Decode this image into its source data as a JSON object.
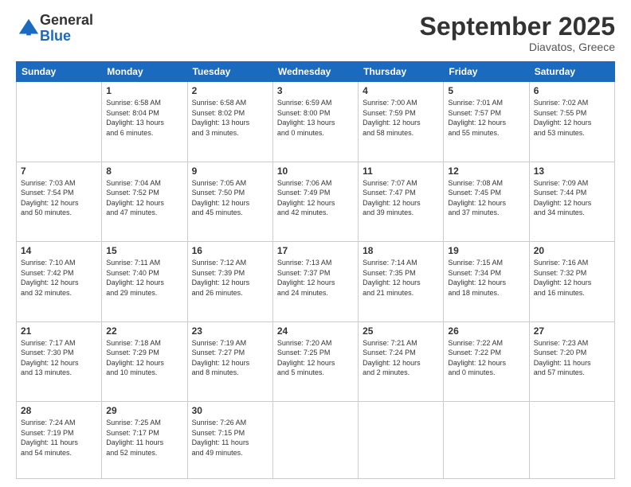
{
  "logo": {
    "general": "General",
    "blue": "Blue"
  },
  "title": "September 2025",
  "location": "Diavatos, Greece",
  "days_of_week": [
    "Sunday",
    "Monday",
    "Tuesday",
    "Wednesday",
    "Thursday",
    "Friday",
    "Saturday"
  ],
  "weeks": [
    [
      {
        "day": "",
        "info": ""
      },
      {
        "day": "1",
        "info": "Sunrise: 6:58 AM\nSunset: 8:04 PM\nDaylight: 13 hours\nand 6 minutes."
      },
      {
        "day": "2",
        "info": "Sunrise: 6:58 AM\nSunset: 8:02 PM\nDaylight: 13 hours\nand 3 minutes."
      },
      {
        "day": "3",
        "info": "Sunrise: 6:59 AM\nSunset: 8:00 PM\nDaylight: 13 hours\nand 0 minutes."
      },
      {
        "day": "4",
        "info": "Sunrise: 7:00 AM\nSunset: 7:59 PM\nDaylight: 12 hours\nand 58 minutes."
      },
      {
        "day": "5",
        "info": "Sunrise: 7:01 AM\nSunset: 7:57 PM\nDaylight: 12 hours\nand 55 minutes."
      },
      {
        "day": "6",
        "info": "Sunrise: 7:02 AM\nSunset: 7:55 PM\nDaylight: 12 hours\nand 53 minutes."
      }
    ],
    [
      {
        "day": "7",
        "info": "Sunrise: 7:03 AM\nSunset: 7:54 PM\nDaylight: 12 hours\nand 50 minutes."
      },
      {
        "day": "8",
        "info": "Sunrise: 7:04 AM\nSunset: 7:52 PM\nDaylight: 12 hours\nand 47 minutes."
      },
      {
        "day": "9",
        "info": "Sunrise: 7:05 AM\nSunset: 7:50 PM\nDaylight: 12 hours\nand 45 minutes."
      },
      {
        "day": "10",
        "info": "Sunrise: 7:06 AM\nSunset: 7:49 PM\nDaylight: 12 hours\nand 42 minutes."
      },
      {
        "day": "11",
        "info": "Sunrise: 7:07 AM\nSunset: 7:47 PM\nDaylight: 12 hours\nand 39 minutes."
      },
      {
        "day": "12",
        "info": "Sunrise: 7:08 AM\nSunset: 7:45 PM\nDaylight: 12 hours\nand 37 minutes."
      },
      {
        "day": "13",
        "info": "Sunrise: 7:09 AM\nSunset: 7:44 PM\nDaylight: 12 hours\nand 34 minutes."
      }
    ],
    [
      {
        "day": "14",
        "info": "Sunrise: 7:10 AM\nSunset: 7:42 PM\nDaylight: 12 hours\nand 32 minutes."
      },
      {
        "day": "15",
        "info": "Sunrise: 7:11 AM\nSunset: 7:40 PM\nDaylight: 12 hours\nand 29 minutes."
      },
      {
        "day": "16",
        "info": "Sunrise: 7:12 AM\nSunset: 7:39 PM\nDaylight: 12 hours\nand 26 minutes."
      },
      {
        "day": "17",
        "info": "Sunrise: 7:13 AM\nSunset: 7:37 PM\nDaylight: 12 hours\nand 24 minutes."
      },
      {
        "day": "18",
        "info": "Sunrise: 7:14 AM\nSunset: 7:35 PM\nDaylight: 12 hours\nand 21 minutes."
      },
      {
        "day": "19",
        "info": "Sunrise: 7:15 AM\nSunset: 7:34 PM\nDaylight: 12 hours\nand 18 minutes."
      },
      {
        "day": "20",
        "info": "Sunrise: 7:16 AM\nSunset: 7:32 PM\nDaylight: 12 hours\nand 16 minutes."
      }
    ],
    [
      {
        "day": "21",
        "info": "Sunrise: 7:17 AM\nSunset: 7:30 PM\nDaylight: 12 hours\nand 13 minutes."
      },
      {
        "day": "22",
        "info": "Sunrise: 7:18 AM\nSunset: 7:29 PM\nDaylight: 12 hours\nand 10 minutes."
      },
      {
        "day": "23",
        "info": "Sunrise: 7:19 AM\nSunset: 7:27 PM\nDaylight: 12 hours\nand 8 minutes."
      },
      {
        "day": "24",
        "info": "Sunrise: 7:20 AM\nSunset: 7:25 PM\nDaylight: 12 hours\nand 5 minutes."
      },
      {
        "day": "25",
        "info": "Sunrise: 7:21 AM\nSunset: 7:24 PM\nDaylight: 12 hours\nand 2 minutes."
      },
      {
        "day": "26",
        "info": "Sunrise: 7:22 AM\nSunset: 7:22 PM\nDaylight: 12 hours\nand 0 minutes."
      },
      {
        "day": "27",
        "info": "Sunrise: 7:23 AM\nSunset: 7:20 PM\nDaylight: 11 hours\nand 57 minutes."
      }
    ],
    [
      {
        "day": "28",
        "info": "Sunrise: 7:24 AM\nSunset: 7:19 PM\nDaylight: 11 hours\nand 54 minutes."
      },
      {
        "day": "29",
        "info": "Sunrise: 7:25 AM\nSunset: 7:17 PM\nDaylight: 11 hours\nand 52 minutes."
      },
      {
        "day": "30",
        "info": "Sunrise: 7:26 AM\nSunset: 7:15 PM\nDaylight: 11 hours\nand 49 minutes."
      },
      {
        "day": "",
        "info": ""
      },
      {
        "day": "",
        "info": ""
      },
      {
        "day": "",
        "info": ""
      },
      {
        "day": "",
        "info": ""
      }
    ]
  ]
}
